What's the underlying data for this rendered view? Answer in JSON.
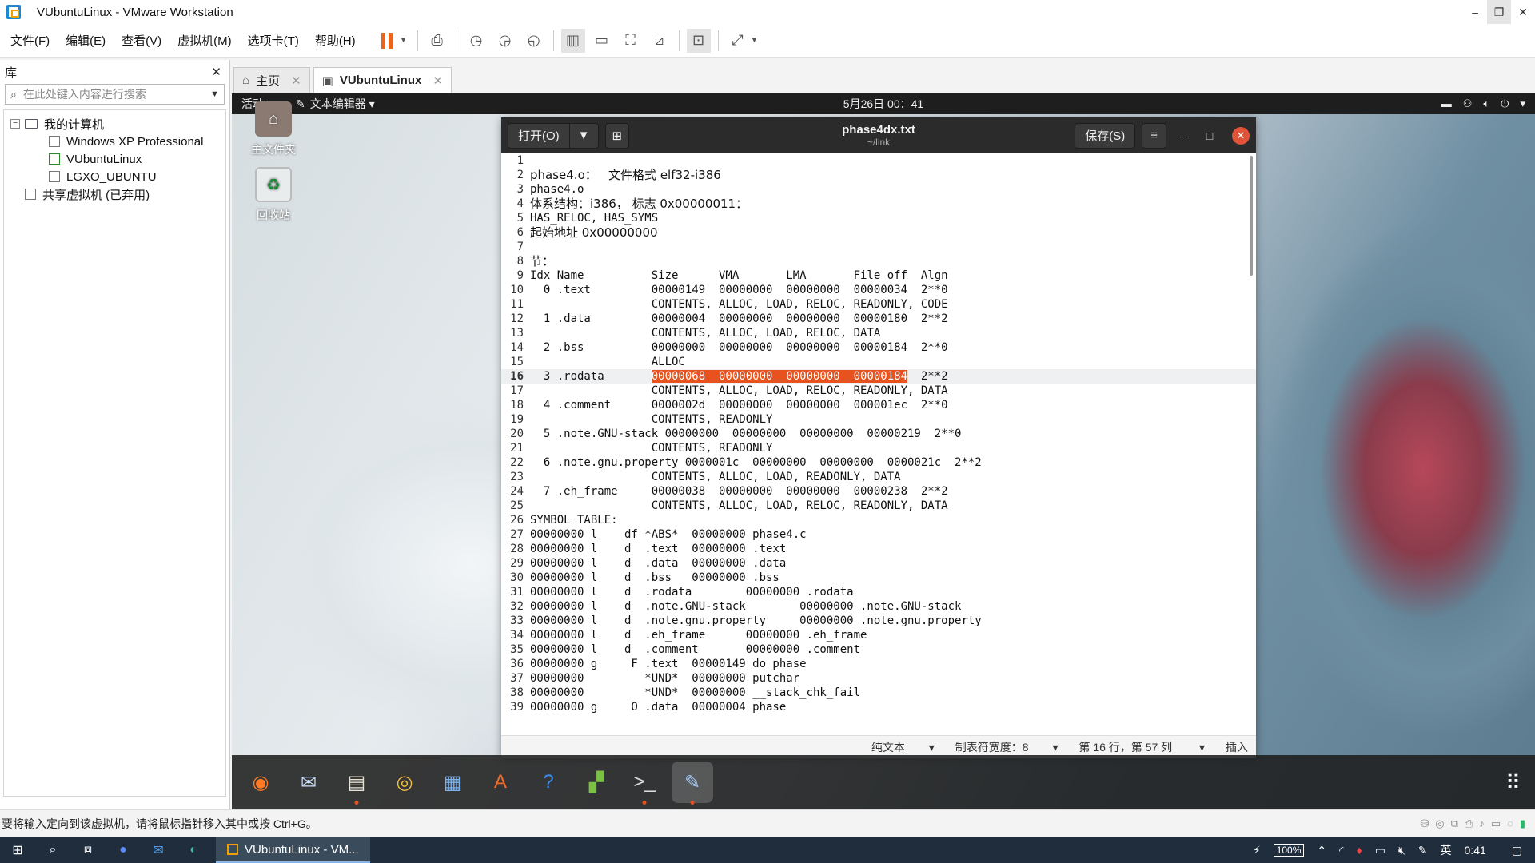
{
  "window": {
    "title": "VUbuntuLinux - VMware Workstation",
    "controls": [
      "–",
      "❐",
      "✕"
    ]
  },
  "menu": [
    "文件(F)",
    "编辑(E)",
    "查看(V)",
    "虚拟机(M)",
    "选项卡(T)",
    "帮助(H)"
  ],
  "library": {
    "title": "库",
    "close": "✕",
    "search_placeholder": "在此处键入内容进行搜索",
    "tree": {
      "root": "我的计算机",
      "vms": [
        "Windows XP Professional",
        "VUbuntuLinux",
        "LGXO_UBUNTU"
      ],
      "shared": "共享虚拟机 (已弃用)"
    }
  },
  "tabs": [
    {
      "label": "主页",
      "close": "✕"
    },
    {
      "label": "VUbuntuLinux",
      "close": "✕"
    }
  ],
  "gnome": {
    "activities": "活动",
    "app_menu": "文本编辑器",
    "clock": "5月26日 00：41"
  },
  "desktop": {
    "home": "主文件夹",
    "trash": "回收站"
  },
  "gedit": {
    "open": "打开(O)",
    "save": "保存(S)",
    "filename": "phase4dx.txt",
    "path": "~/link",
    "lines": [
      {
        "n": "1",
        "t": ""
      },
      {
        "n": "2",
        "t": "phase4.o：   文件格式 elf32-i386"
      },
      {
        "n": "3",
        "t": "phase4.o"
      },
      {
        "n": "4",
        "t": "体系结构：i386， 标志 0x00000011："
      },
      {
        "n": "5",
        "t": "HAS_RELOC, HAS_SYMS"
      },
      {
        "n": "6",
        "t": "起始地址 0x00000000"
      },
      {
        "n": "7",
        "t": ""
      },
      {
        "n": "8",
        "t": "节："
      },
      {
        "n": "9",
        "t": "Idx Name          Size      VMA       LMA       File off  Algn"
      },
      {
        "n": "10",
        "t": "  0 .text         00000149  00000000  00000000  00000034  2**0"
      },
      {
        "n": "11",
        "t": "                  CONTENTS, ALLOC, LOAD, RELOC, READONLY, CODE"
      },
      {
        "n": "12",
        "t": "  1 .data         00000004  00000000  00000000  00000180  2**2"
      },
      {
        "n": "13",
        "t": "                  CONTENTS, ALLOC, LOAD, RELOC, DATA"
      },
      {
        "n": "14",
        "t": "  2 .bss          00000000  00000000  00000000  00000184  2**0"
      },
      {
        "n": "15",
        "t": "                  ALLOC"
      },
      {
        "n": "16",
        "pre": "  3 .rodata       ",
        "sel": "00000068  00000000  00000000  00000184",
        "post": "  2**2"
      },
      {
        "n": "17",
        "t": "                  CONTENTS, ALLOC, LOAD, RELOC, READONLY, DATA"
      },
      {
        "n": "18",
        "t": "  4 .comment      0000002d  00000000  00000000  000001ec  2**0"
      },
      {
        "n": "19",
        "t": "                  CONTENTS, READONLY"
      },
      {
        "n": "20",
        "t": "  5 .note.GNU-stack 00000000  00000000  00000000  00000219  2**0"
      },
      {
        "n": "21",
        "t": "                  CONTENTS, READONLY"
      },
      {
        "n": "22",
        "t": "  6 .note.gnu.property 0000001c  00000000  00000000  0000021c  2**2"
      },
      {
        "n": "23",
        "t": "                  CONTENTS, ALLOC, LOAD, READONLY, DATA"
      },
      {
        "n": "24",
        "t": "  7 .eh_frame     00000038  00000000  00000000  00000238  2**2"
      },
      {
        "n": "25",
        "t": "                  CONTENTS, ALLOC, LOAD, RELOC, READONLY, DATA"
      },
      {
        "n": "26",
        "t": "SYMBOL TABLE:"
      },
      {
        "n": "27",
        "t": "00000000 l    df *ABS*  00000000 phase4.c"
      },
      {
        "n": "28",
        "t": "00000000 l    d  .text  00000000 .text"
      },
      {
        "n": "29",
        "t": "00000000 l    d  .data  00000000 .data"
      },
      {
        "n": "30",
        "t": "00000000 l    d  .bss   00000000 .bss"
      },
      {
        "n": "31",
        "t": "00000000 l    d  .rodata        00000000 .rodata"
      },
      {
        "n": "32",
        "t": "00000000 l    d  .note.GNU-stack        00000000 .note.GNU-stack"
      },
      {
        "n": "33",
        "t": "00000000 l    d  .note.gnu.property     00000000 .note.gnu.property"
      },
      {
        "n": "34",
        "t": "00000000 l    d  .eh_frame      00000000 .eh_frame"
      },
      {
        "n": "35",
        "t": "00000000 l    d  .comment       00000000 .comment"
      },
      {
        "n": "36",
        "t": "00000000 g     F .text  00000149 do_phase"
      },
      {
        "n": "37",
        "t": "00000000         *UND*  00000000 putchar"
      },
      {
        "n": "38",
        "t": "00000000         *UND*  00000000 __stack_chk_fail"
      },
      {
        "n": "39",
        "t": "00000000 g     O .data  00000004 phase"
      }
    ],
    "status": {
      "mode": "纯文本",
      "tab_width": "制表符宽度：8",
      "position": "第 16 行，第 57 列",
      "insert": "插入"
    }
  },
  "vm_status_text": "要将输入定向到该虚拟机，请将鼠标指针移入其中或按 Ctrl+G。",
  "taskbar": {
    "running_app": "VUbuntuLinux - VM...",
    "battery": "100%",
    "ime": "英",
    "time": "0:41"
  },
  "colors": {
    "selection": "#e8521f",
    "accent_orange": "#e8671c"
  }
}
